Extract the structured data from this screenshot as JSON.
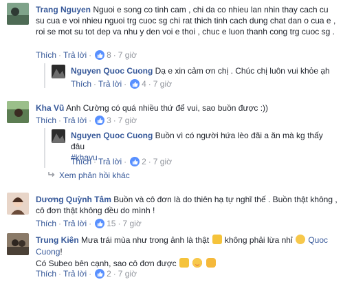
{
  "comments": [
    {
      "author": "Trang Nguyen",
      "text": "Nguoi e song co tinh cam , chi da co nhieu lan nhin thay cach cu su cua e voi nhieu nguoi trg cuoc sg chi rat thich tinh cach dung chat dan o cua e , roi se mot su tot dep va nhu y den voi e thoi , chuc e luon thanh cong trg cuoc sg .",
      "like": "Thích",
      "reply": "Trả lời",
      "count": "8",
      "time": "7 giờ"
    },
    {
      "author": "Nguyen Quoc Cuong",
      "text": "Dạ e xin cảm ơn chị . Chúc chị luôn vui khỏe ạh",
      "like": "Thích",
      "reply": "Trả lời",
      "count": "4",
      "time": "7 giờ"
    },
    {
      "author": "Kha Vũ",
      "text": "Anh Cường có quá nhiều thứ để vui, sao buồn được :))",
      "like": "Thích",
      "reply": "Trả lời",
      "count": "3",
      "time": "7 giờ"
    },
    {
      "author": "Nguyen Quoc Cuong",
      "text": "Buồn vì có người hứa lèo đãi a ăn mà kg thấy đâu",
      "hashtag": "#khavu",
      "like": "Thích",
      "reply": "Trả lời",
      "count": "2",
      "time": "7 giờ"
    },
    {
      "author": "Dương Quỳnh Tâm",
      "text": "Buồn và cô đơn là do thiên hạ tự nghĩ thế . Buồn thật không , cô đơn thật không đều do mình !",
      "like": "Thích",
      "reply": "Trả lời",
      "count": "15",
      "time": "7 giờ"
    },
    {
      "author": "Trung Kiên",
      "text_a": "Mưa trái mùa như trong ảnh là thật",
      "text_b": "không phải lừa nhỉ",
      "mention": "Quoc Cuong",
      "text_c": "!",
      "line2": "Có Subeo bên cạnh, sao cô đơn được",
      "like": "Thích",
      "reply": "Trả lời",
      "count": "2",
      "time": "7 giờ"
    }
  ],
  "view_more": "Xem phản hồi khác",
  "dot": "·",
  "icons": {
    "like": "like-thumb-icon",
    "reply_arrow": "reply-arrow-icon"
  },
  "colors": {
    "link": "#365899",
    "meta": "#90949c",
    "like_badge": "#5890ff"
  }
}
